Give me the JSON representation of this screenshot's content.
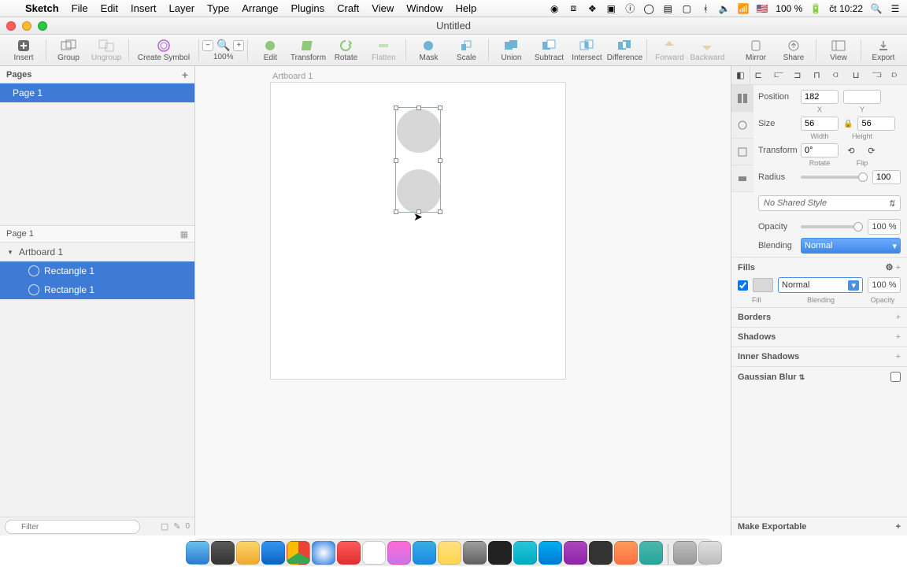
{
  "menubar": {
    "app": "Sketch",
    "items": [
      "File",
      "Edit",
      "Insert",
      "Layer",
      "Type",
      "Arrange",
      "Plugins",
      "Craft",
      "View",
      "Window",
      "Help"
    ],
    "battery": "100 %",
    "clock": "čt 10:22"
  },
  "window": {
    "title": "Untitled"
  },
  "toolbar": {
    "insert": "Insert",
    "group": "Group",
    "ungroup": "Ungroup",
    "create_symbol": "Create Symbol",
    "zoom": "100%",
    "edit": "Edit",
    "transform": "Transform",
    "rotate": "Rotate",
    "flatten": "Flatten",
    "mask": "Mask",
    "scale": "Scale",
    "union": "Union",
    "subtract": "Subtract",
    "intersect": "Intersect",
    "difference": "Difference",
    "forward": "Forward",
    "backward": "Backward",
    "mirror": "Mirror",
    "share": "Share",
    "view": "View",
    "export": "Export"
  },
  "pages": {
    "header": "Pages",
    "items": [
      "Page 1"
    ]
  },
  "layers": {
    "header": "Page 1",
    "artboard": "Artboard 1",
    "items": [
      "Rectangle 1",
      "Rectangle 1"
    ],
    "filter_placeholder": "Filter",
    "count": "0"
  },
  "canvas": {
    "artboard_label": "Artboard 1"
  },
  "inspector": {
    "position_label": "Position",
    "position_x": "182",
    "position_y": "",
    "x_label": "X",
    "y_label": "Y",
    "size_label": "Size",
    "size_w": "56",
    "size_h": "56",
    "w_label": "Width",
    "h_label": "Height",
    "transform_label": "Transform",
    "rotate_val": "0°",
    "rotate_label": "Rotate",
    "flip_label": "Flip",
    "radius_label": "Radius",
    "radius_val": "100",
    "shared_style": "No Shared Style",
    "opacity_label": "Opacity",
    "opacity_val": "100 %",
    "blending_label": "Blending",
    "blending_val": "Normal",
    "fills_label": "Fills",
    "fill_blend": "Normal",
    "fill_opacity": "100 %",
    "fill_l": "Fill",
    "blend_l": "Blending",
    "op_l": "Opacity",
    "borders_label": "Borders",
    "shadows_label": "Shadows",
    "inner_label": "Inner Shadows",
    "blur_label": "Gaussian Blur",
    "export_label": "Make Exportable"
  }
}
